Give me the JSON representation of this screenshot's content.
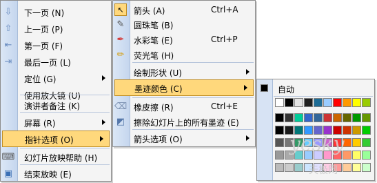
{
  "menu1": {
    "items": [
      {
        "label": "下一页 (N)",
        "icon": "down-arrow-icon"
      },
      {
        "label": "上一页 (P)",
        "icon": "up-arrow-icon"
      },
      {
        "label": "第一页 (F)",
        "icon": "first-page-icon"
      },
      {
        "label": "最后一页 (L)",
        "icon": "last-page-icon"
      },
      {
        "label": "定位 (G)"
      },
      {
        "label": "使用放大镜 (U)"
      },
      {
        "label": "演讲者备注 (K)"
      },
      {
        "label": "屏幕 (R)"
      },
      {
        "label": "指针选项 (O)"
      },
      {
        "label": "幻灯片放映帮助 (H)",
        "icon": "keyboard-icon"
      },
      {
        "label": "结束放映 (E)",
        "icon": "end-show-icon"
      }
    ]
  },
  "menu2": {
    "items": [
      {
        "label": "箭头 (A)",
        "shortcut": "Ctrl+A",
        "icon": "arrow-cursor-icon"
      },
      {
        "label": "圆珠笔 (B)",
        "icon": "ballpoint-pen-icon"
      },
      {
        "label": "水彩笔 (E)",
        "shortcut": "Ctrl+P",
        "icon": "felt-pen-icon"
      },
      {
        "label": "荧光笔 (H)",
        "icon": "highlighter-icon"
      },
      {
        "label": "绘制形状 (U)"
      },
      {
        "label": "墨迹颜色 (C)"
      },
      {
        "label": "橡皮擦 (R)",
        "shortcut": "Ctrl+E",
        "icon": "eraser-icon"
      },
      {
        "label": "擦除幻灯片上的所有墨迹 (E)",
        "icon": "erase-all-icon"
      },
      {
        "label": "箭头选项 (O)"
      }
    ]
  },
  "menu3": {
    "auto_label": "自动",
    "auto_color": "#000000",
    "row1": [
      "#ffffff",
      "#000000",
      "#e2e2e2",
      "#1f1f1f",
      "#1d6b95",
      "#99ccff",
      "#ff0000",
      "#ff9900",
      "#ffff00",
      "#99cc00"
    ],
    "row2": [
      "#000000",
      "#333333",
      "#00cc99",
      "#3366cc",
      "#336699",
      "#cc3333",
      "#cc6600",
      "#666600",
      "#009900",
      "#669900"
    ],
    "row3": [
      "#000000",
      "#1a1a1a",
      "#007777",
      "#3399ff",
      "#6666cc",
      "#9933cc",
      "#cc0000",
      "#cc3300",
      "#cc9900",
      "#00cc00"
    ],
    "row4": [
      "#555555",
      "#777777",
      "#339966",
      "#66ccff",
      "#9999ff",
      "#cc66cc",
      "#ff3333",
      "#ff6600",
      "#ffcc00",
      "#33cc33"
    ],
    "row5": [
      "#999999",
      "#aaaaaa",
      "#66cccc",
      "#99ccff",
      "#ccccff",
      "#ff99cc",
      "#ff6666",
      "#ff9966",
      "#ffff66",
      "#99ff99"
    ],
    "row6": [
      "#bbbbbb",
      "#cccccc",
      "#99cccc",
      "#cce5ff",
      "#e0e0ff",
      "#ffcce5",
      "#ff9999",
      "#ffcc99",
      "#ffff99",
      "#ccffcc"
    ]
  },
  "watermark": {
    "brand": "yesky",
    "site": "天极网"
  }
}
